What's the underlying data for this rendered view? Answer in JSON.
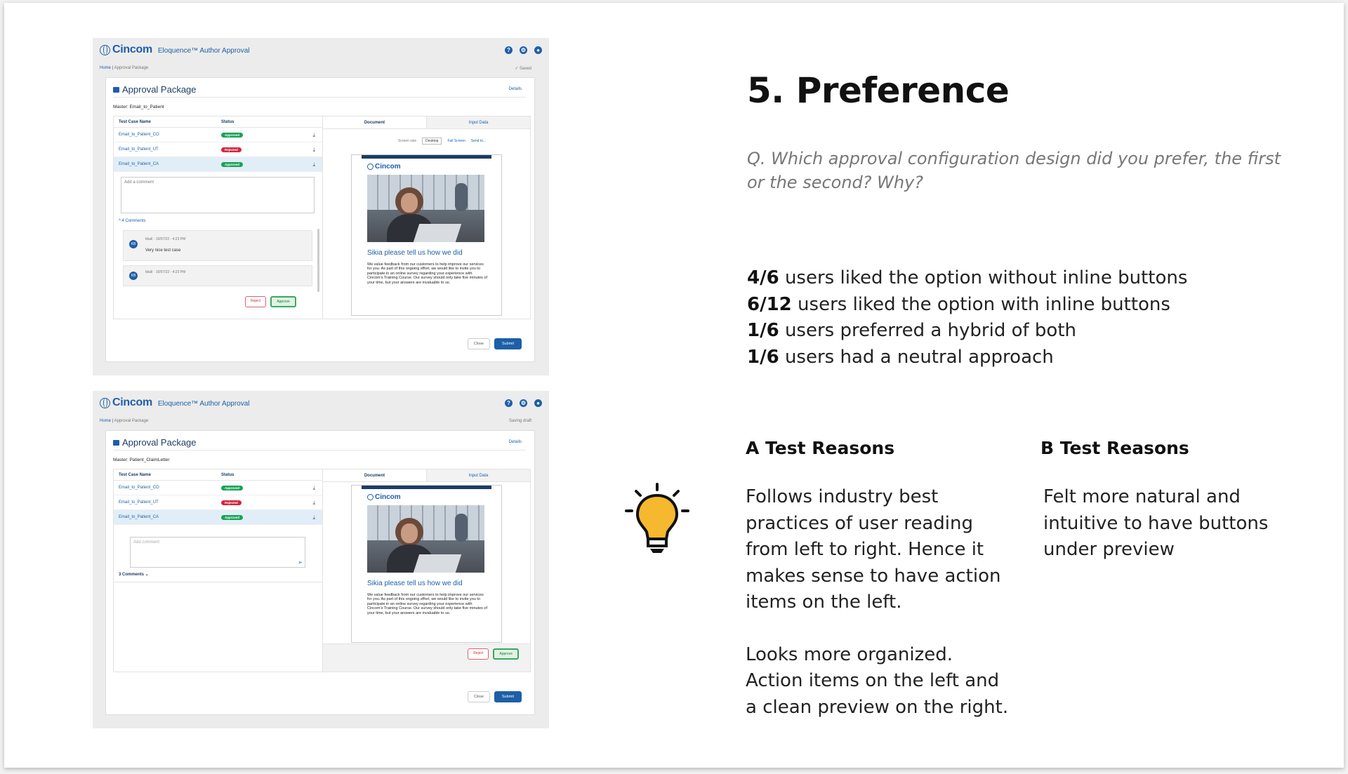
{
  "slide": {
    "title": "5. Preference",
    "question": "Q. Which approval configuration design did you prefer, the first or the second? Why?",
    "stats": [
      {
        "num": "4/6",
        "text": " users liked the option without inline buttons"
      },
      {
        "num": "6/12",
        "text": " users liked the option with inline buttons"
      },
      {
        "num": "1/6",
        "text": " users preferred a hybrid of both"
      },
      {
        "num": "1/6",
        "text": " users had a neutral approach"
      }
    ],
    "a_heading": "A Test Reasons",
    "a_para1": "Follows industry best practices of user reading from left to right. Hence it makes sense to have action items on the left.",
    "a_para2": "Looks more organized. Action items on the left and a clean preview on the right.",
    "b_heading": "B Test Reasons",
    "b_para1": "Felt more natural and intuitive to have buttons under preview",
    "bulb_icon": "lightbulb-icon",
    "bulb_color": "#f5b82e"
  },
  "shot1": {
    "brand": "Cincom",
    "product": "Eloquence™ Author Approval",
    "crumb_home": "Home",
    "crumb_page": "Approval Package",
    "save_state": "✓ Saved",
    "title": "Approval Package",
    "details": "Details",
    "master": "Master: Email_to_Patient",
    "col_name": "Test Case Name",
    "col_status": "Status",
    "rows": [
      {
        "name": "Email_to_Patient_CO",
        "status": "Approved"
      },
      {
        "name": "Email_to_Patient_UT",
        "status": "Rejected"
      },
      {
        "name": "Email_to_Patient_CA",
        "status": "Approved"
      }
    ],
    "comment_placeholder": "Add a comment",
    "comment_count": "^ 4 Comments",
    "comments": [
      {
        "avatar": "KB",
        "meta": "kball · 10/07/22 - 4:23 PM",
        "text": "Very nice test case"
      },
      {
        "avatar": "KB",
        "meta": "kball · 10/07/22 - 4:23 PM",
        "text": ""
      }
    ],
    "reject": "Reject",
    "approve": "Approve",
    "tab_document": "Document",
    "tab_input": "Input Data",
    "screen_size_label": "Screen size",
    "screen_size_value": "Desktop",
    "full_screen": "Full Screen",
    "send_to": "Send to...",
    "close": "Close",
    "submit": "Submit"
  },
  "shot2": {
    "brand": "Cincom",
    "product": "Eloquence™ Author Approval",
    "crumb_home": "Home",
    "crumb_page": "Approval Package",
    "save_state": "Saving draft",
    "title": "Approval Package",
    "details": "Details",
    "master": "Master: Patient_ClaimLetter",
    "col_name": "Test Case Name",
    "col_status": "Status",
    "rows": [
      {
        "name": "Email_to_Patient_CO",
        "status": "Approved"
      },
      {
        "name": "Email_to_Patient_UT",
        "status": "Rejected"
      },
      {
        "name": "Email_to_Patient_CA",
        "status": "Approved"
      }
    ],
    "comment_placeholder": "Add comment",
    "comment_count": "3 Comments ⌄",
    "reject": "Reject",
    "approve": "Approve",
    "tab_document": "Document",
    "tab_input": "Input Data",
    "close": "Close",
    "submit": "Submit"
  },
  "email_preview": {
    "brand": "Cincom",
    "headline": "Sikia please tell us how we did",
    "body": "We value feedback from our customers to help improve our services for you. As part of this ongoing effort, we would like to invite you to participate in an online survey regarding your experience with Cincom's Training Course. Our survey should only take five minutes of your time, but your answers are invaluable to us."
  }
}
